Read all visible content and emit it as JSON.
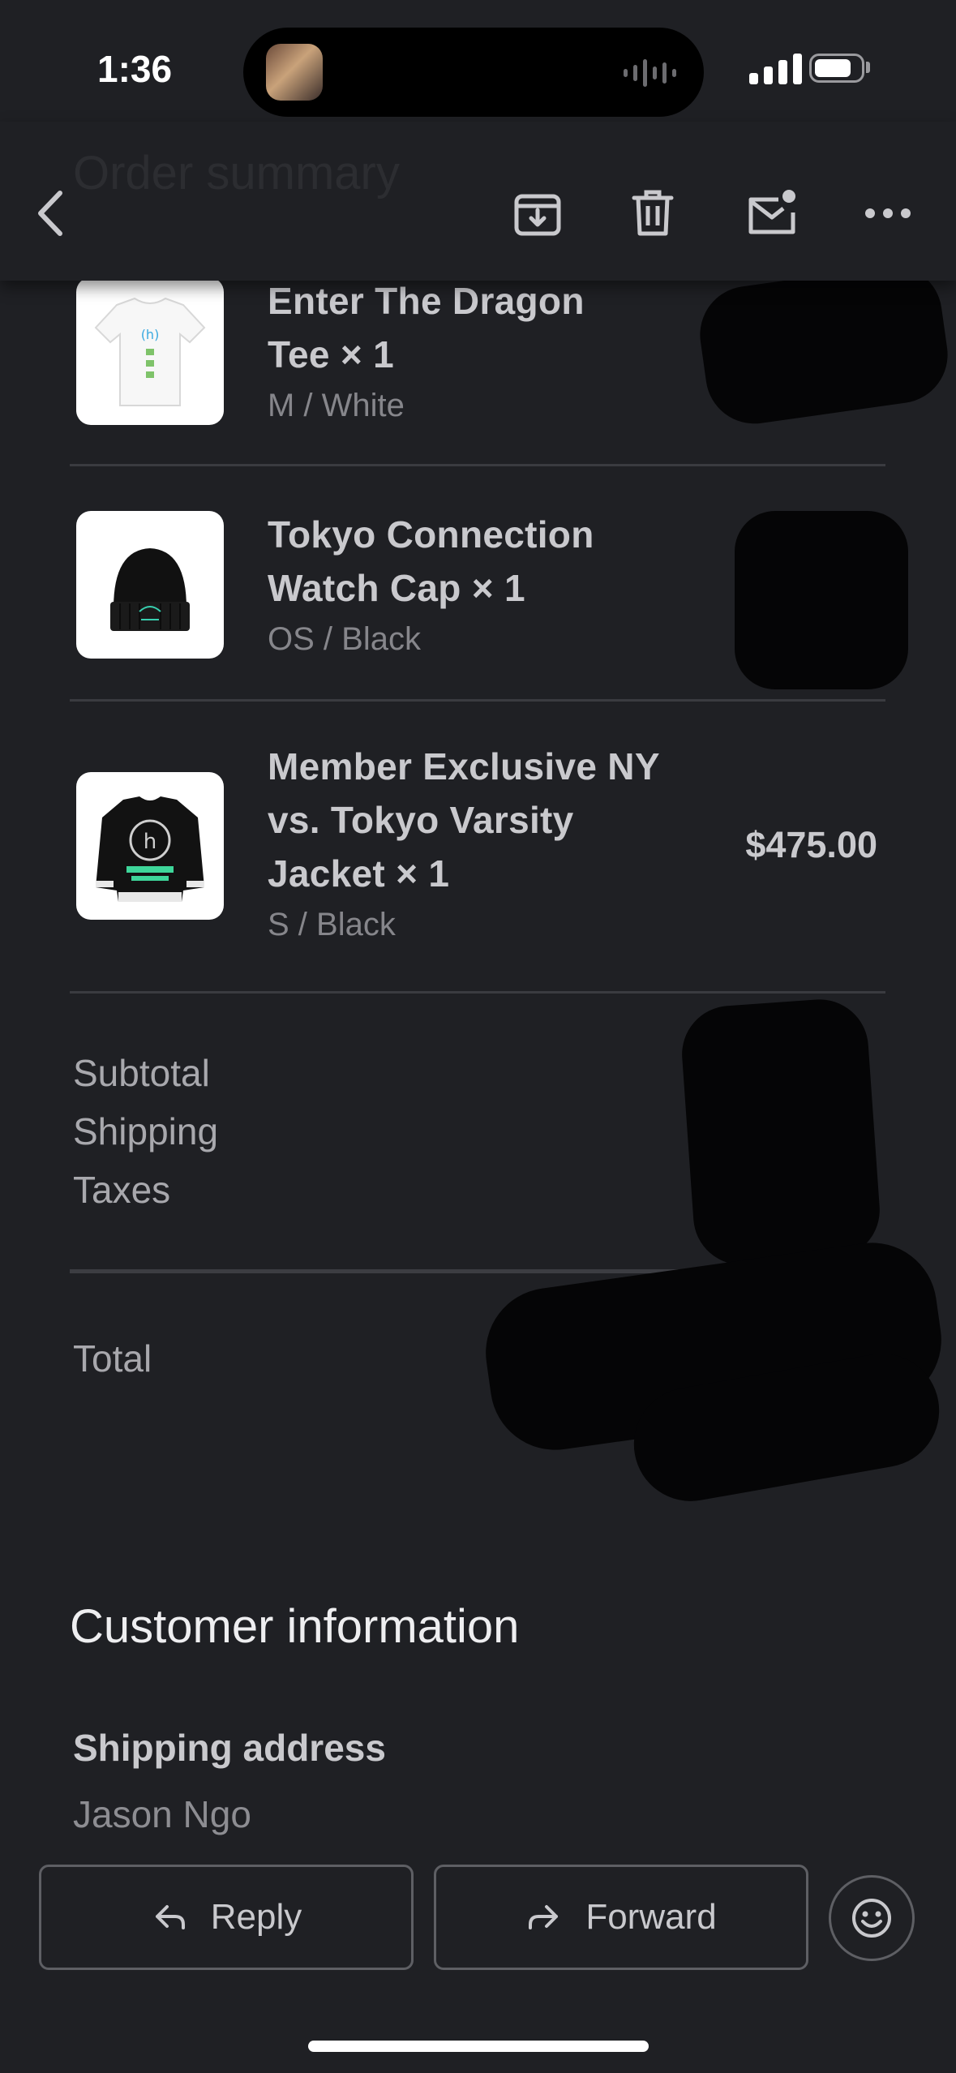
{
  "status_bar": {
    "time": "1:36"
  },
  "header": {
    "title_ghost": "Order summary"
  },
  "items": [
    {
      "title_line1": "Enter The Dragon",
      "title_line2": "Tee × 1",
      "variant": "M / White"
    },
    {
      "title_line1": "Tokyo Connection",
      "title_line2": "Watch Cap × 1",
      "variant": "OS / Black"
    },
    {
      "title_line1": "Member Exclusive NY",
      "title_line2": "vs. Tokyo Varsity",
      "title_line3": "Jacket × 1",
      "variant": "S / Black",
      "price": "$475.00"
    }
  ],
  "summary": {
    "subtotal_label": "Subtotal",
    "shipping_label": "Shipping",
    "taxes_label": "Taxes",
    "total_label": "Total"
  },
  "customer": {
    "section_title": "Customer information",
    "shipping_address_label": "Shipping address",
    "name": "Jason Ngo"
  },
  "actions": {
    "reply": "Reply",
    "forward": "Forward"
  },
  "icons": {
    "back": "chevron-left-icon",
    "archive": "archive-icon",
    "delete": "trash-icon",
    "unread": "mail-unread-icon",
    "more": "more-horizontal-icon",
    "reply": "reply-arrow-icon",
    "forward": "forward-arrow-icon",
    "emoji": "smiley-icon"
  },
  "colors": {
    "background": "#1f2024",
    "text": "#c9c9cd",
    "muted": "#86868b",
    "divider": "#3a3b40"
  }
}
